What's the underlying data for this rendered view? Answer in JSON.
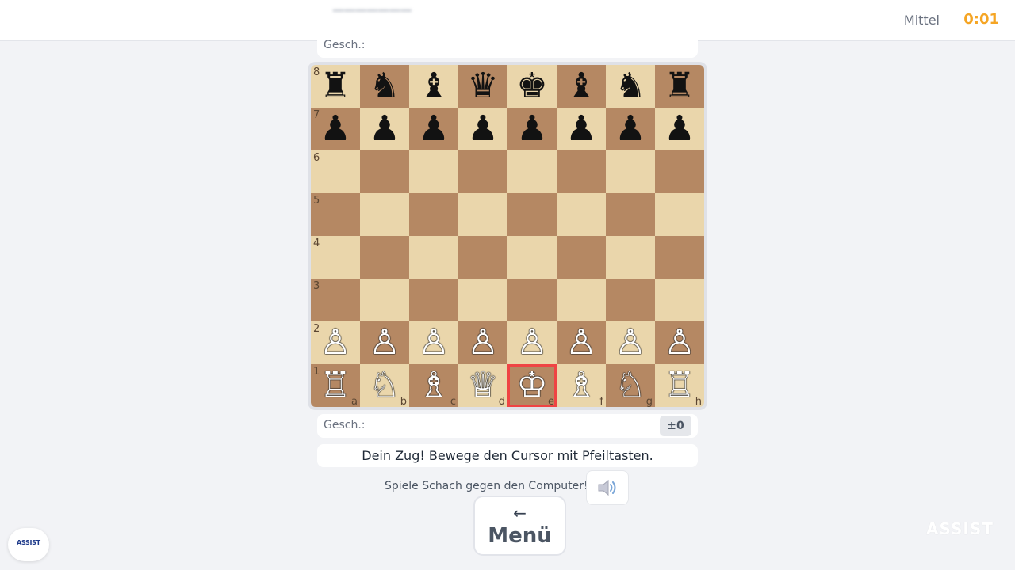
{
  "header": {
    "level": "Mittel",
    "timer": "0:01"
  },
  "captured_top": {
    "label": "Gesch.:"
  },
  "captured_bottom": {
    "label": "Gesch.:",
    "score": "±0"
  },
  "board": {
    "ranks": [
      "8",
      "7",
      "6",
      "5",
      "4",
      "3",
      "2",
      "1"
    ],
    "files": [
      "a",
      "b",
      "c",
      "d",
      "e",
      "f",
      "g",
      "h"
    ],
    "position": [
      [
        "r",
        "n",
        "b",
        "q",
        "k",
        "b",
        "n",
        "r"
      ],
      [
        "p",
        "p",
        "p",
        "p",
        "p",
        "p",
        "p",
        "p"
      ],
      [
        "",
        "",
        "",
        "",
        "",
        "",
        "",
        ""
      ],
      [
        "",
        "",
        "",
        "",
        "",
        "",
        "",
        ""
      ],
      [
        "",
        "",
        "",
        "",
        "",
        "",
        "",
        ""
      ],
      [
        "",
        "",
        "",
        "",
        "",
        "",
        "",
        ""
      ],
      [
        "P",
        "P",
        "P",
        "P",
        "P",
        "P",
        "P",
        "P"
      ],
      [
        "R",
        "N",
        "B",
        "Q",
        "K",
        "B",
        "N",
        "R"
      ]
    ],
    "cursor_square": "e1",
    "colors": {
      "light": "#ead6ab",
      "dark": "#b58863",
      "cursor": "#ef4444"
    }
  },
  "status_message": "Dein Zug! Bewege den Cursor mit Pfeiltasten.",
  "subtitle": "Spiele Schach gegen den Computer!",
  "sound": {
    "icon": "speaker-icon"
  },
  "menu": {
    "arrow": "←",
    "label": "Menü"
  },
  "brand": {
    "badge_text": "ASSIST",
    "watermark": "ASSIST"
  },
  "accent_color": "#f5a524"
}
